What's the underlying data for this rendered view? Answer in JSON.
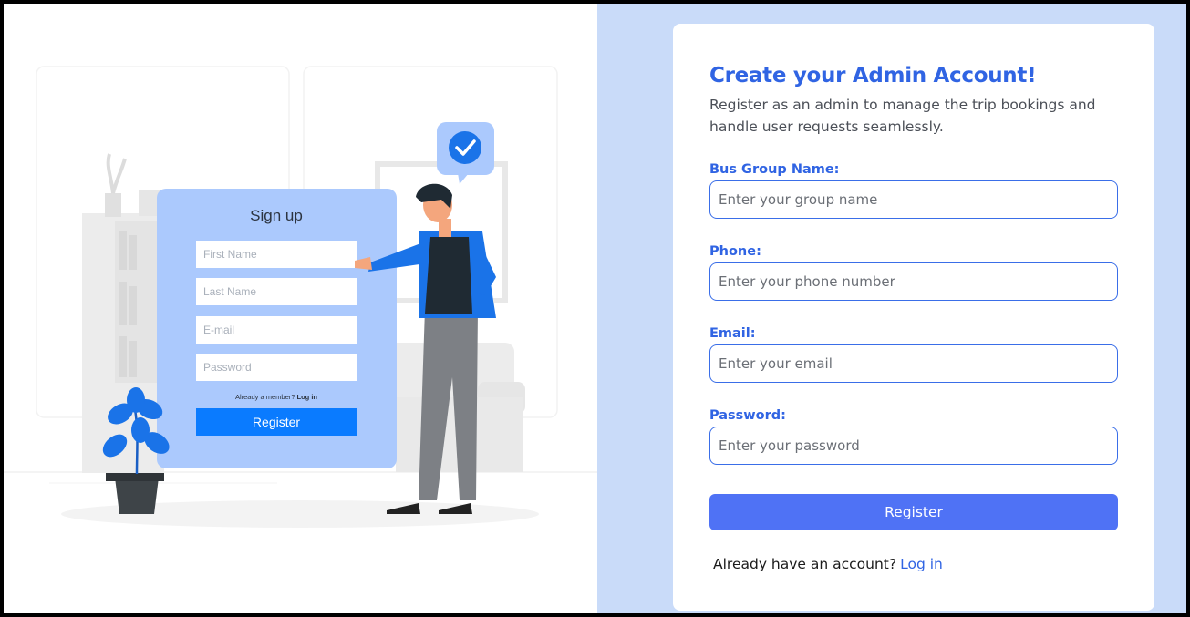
{
  "illustration": {
    "form_title": "Sign up",
    "fields": [
      "First Name",
      "Last Name",
      "E-mail",
      "Password"
    ],
    "member_text": "Already a member?",
    "member_link": "Log in",
    "button_label": "Register",
    "colors": {
      "card": "#abc9fd",
      "button": "#0a7bff",
      "accent": "#1a73e8"
    }
  },
  "form": {
    "title": "Create your Admin Account!",
    "subtitle": "Register as an admin to manage the trip bookings and handle user requests seamlessly.",
    "fields": [
      {
        "label": "Bus Group Name:",
        "placeholder": "Enter your group name"
      },
      {
        "label": "Phone:",
        "placeholder": "Enter your phone number"
      },
      {
        "label": "Email:",
        "placeholder": "Enter your email"
      },
      {
        "label": "Password:",
        "placeholder": "Enter your password"
      }
    ],
    "submit_label": "Register",
    "footer_text": "Already have an account?",
    "footer_link": "Log in"
  },
  "colors": {
    "primary": "#3064e3",
    "button": "#4f72f5",
    "panel_bg": "#c9dbf9"
  }
}
